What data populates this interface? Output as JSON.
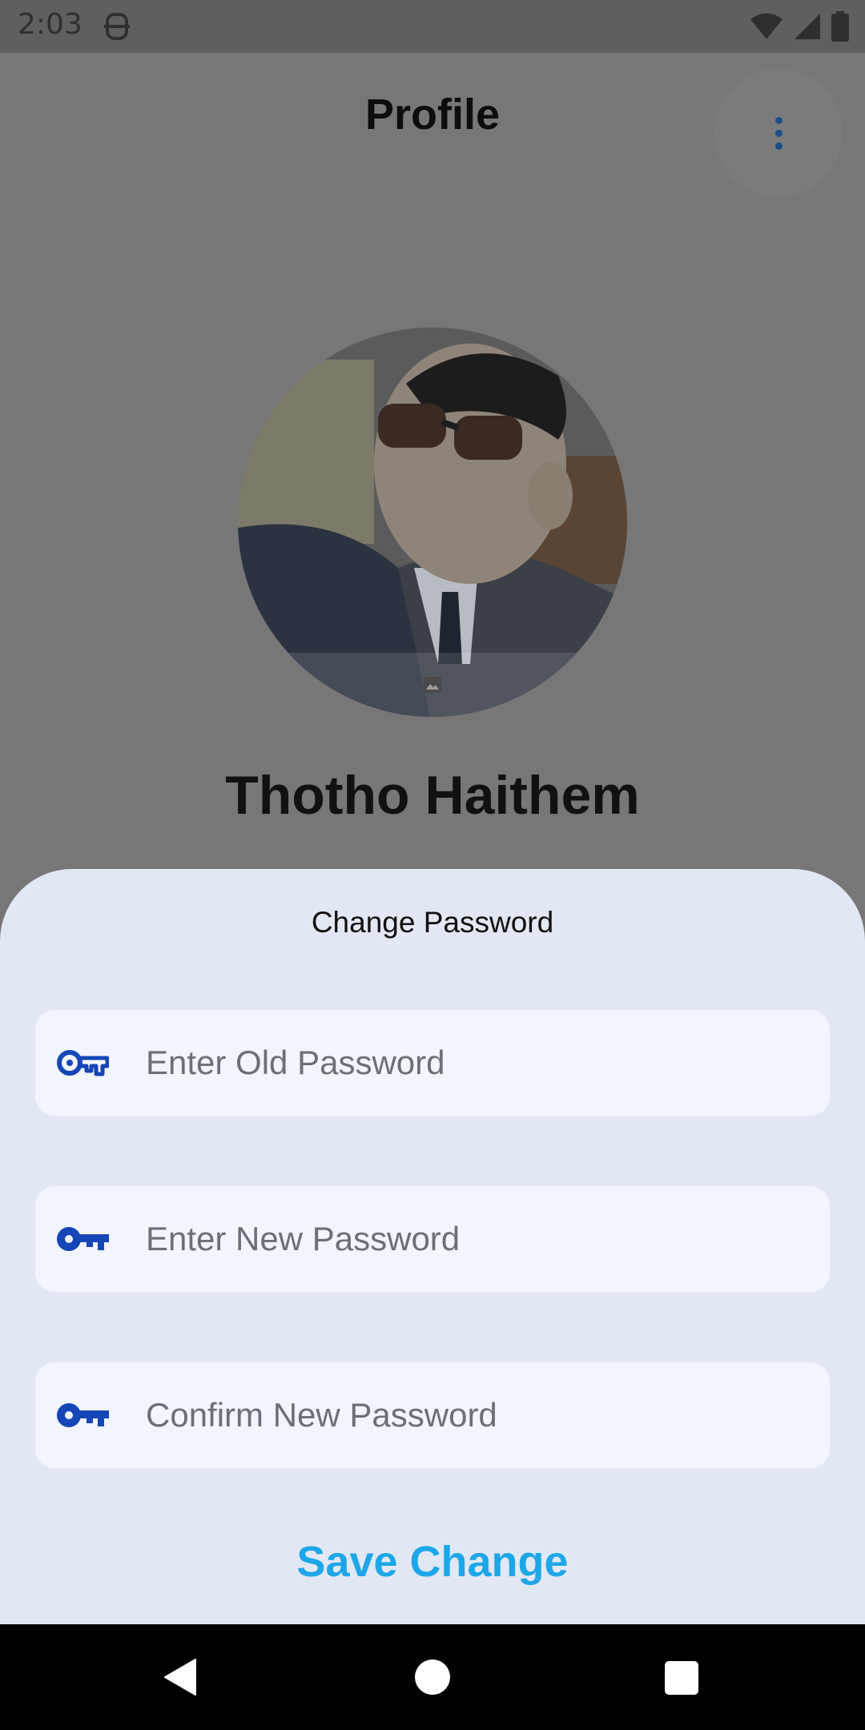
{
  "status_bar": {
    "time": "2:03"
  },
  "header": {
    "title": "Profile"
  },
  "profile": {
    "name": "Thotho Haithem"
  },
  "sheet": {
    "title": "Change Password",
    "fields": [
      {
        "placeholder": "Enter Old Password",
        "icon": "key-outline-icon"
      },
      {
        "placeholder": "Enter New Password",
        "icon": "key-icon"
      },
      {
        "placeholder": "Confirm New Password",
        "icon": "key-icon"
      }
    ],
    "save_label": "Save Change"
  },
  "colors": {
    "accent": "#1ea7e8",
    "icon_blue": "#1546b8",
    "sheet_bg": "#e2e8f3",
    "field_bg": "#f2f5fd",
    "scrim": "#777777"
  }
}
